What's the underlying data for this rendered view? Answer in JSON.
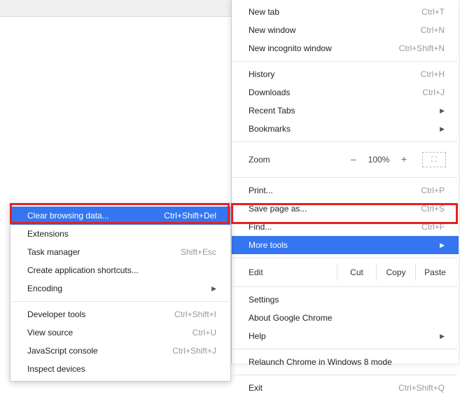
{
  "main": {
    "new_tab": {
      "label": "New tab",
      "shortcut": "Ctrl+T"
    },
    "new_window": {
      "label": "New window",
      "shortcut": "Ctrl+N"
    },
    "new_incognito": {
      "label": "New incognito window",
      "shortcut": "Ctrl+Shift+N"
    },
    "history": {
      "label": "History",
      "shortcut": "Ctrl+H"
    },
    "downloads": {
      "label": "Downloads",
      "shortcut": "Ctrl+J"
    },
    "recent_tabs": {
      "label": "Recent Tabs"
    },
    "bookmarks": {
      "label": "Bookmarks"
    },
    "zoom": {
      "label": "Zoom",
      "minus": "–",
      "value": "100%",
      "plus": "+"
    },
    "print": {
      "label": "Print...",
      "shortcut": "Ctrl+P"
    },
    "save_as": {
      "label": "Save page as...",
      "shortcut": "Ctrl+S"
    },
    "find": {
      "label": "Find...",
      "shortcut": "Ctrl+F"
    },
    "more_tools": {
      "label": "More tools"
    },
    "edit": {
      "label": "Edit",
      "cut": "Cut",
      "copy": "Copy",
      "paste": "Paste"
    },
    "settings": {
      "label": "Settings"
    },
    "about": {
      "label": "About Google Chrome"
    },
    "help": {
      "label": "Help"
    },
    "relaunch": {
      "label": "Relaunch Chrome in Windows 8 mode"
    },
    "exit": {
      "label": "Exit",
      "shortcut": "Ctrl+Shift+Q"
    }
  },
  "sub": {
    "clear_data": {
      "label": "Clear browsing data...",
      "shortcut": "Ctrl+Shift+Del"
    },
    "extensions": {
      "label": "Extensions"
    },
    "task_manager": {
      "label": "Task manager",
      "shortcut": "Shift+Esc"
    },
    "create_shortcuts": {
      "label": "Create application shortcuts..."
    },
    "encoding": {
      "label": "Encoding"
    },
    "dev_tools": {
      "label": "Developer tools",
      "shortcut": "Ctrl+Shift+I"
    },
    "view_source": {
      "label": "View source",
      "shortcut": "Ctrl+U"
    },
    "js_console": {
      "label": "JavaScript console",
      "shortcut": "Ctrl+Shift+J"
    },
    "inspect_devices": {
      "label": "Inspect devices"
    }
  },
  "arrow": "▶"
}
